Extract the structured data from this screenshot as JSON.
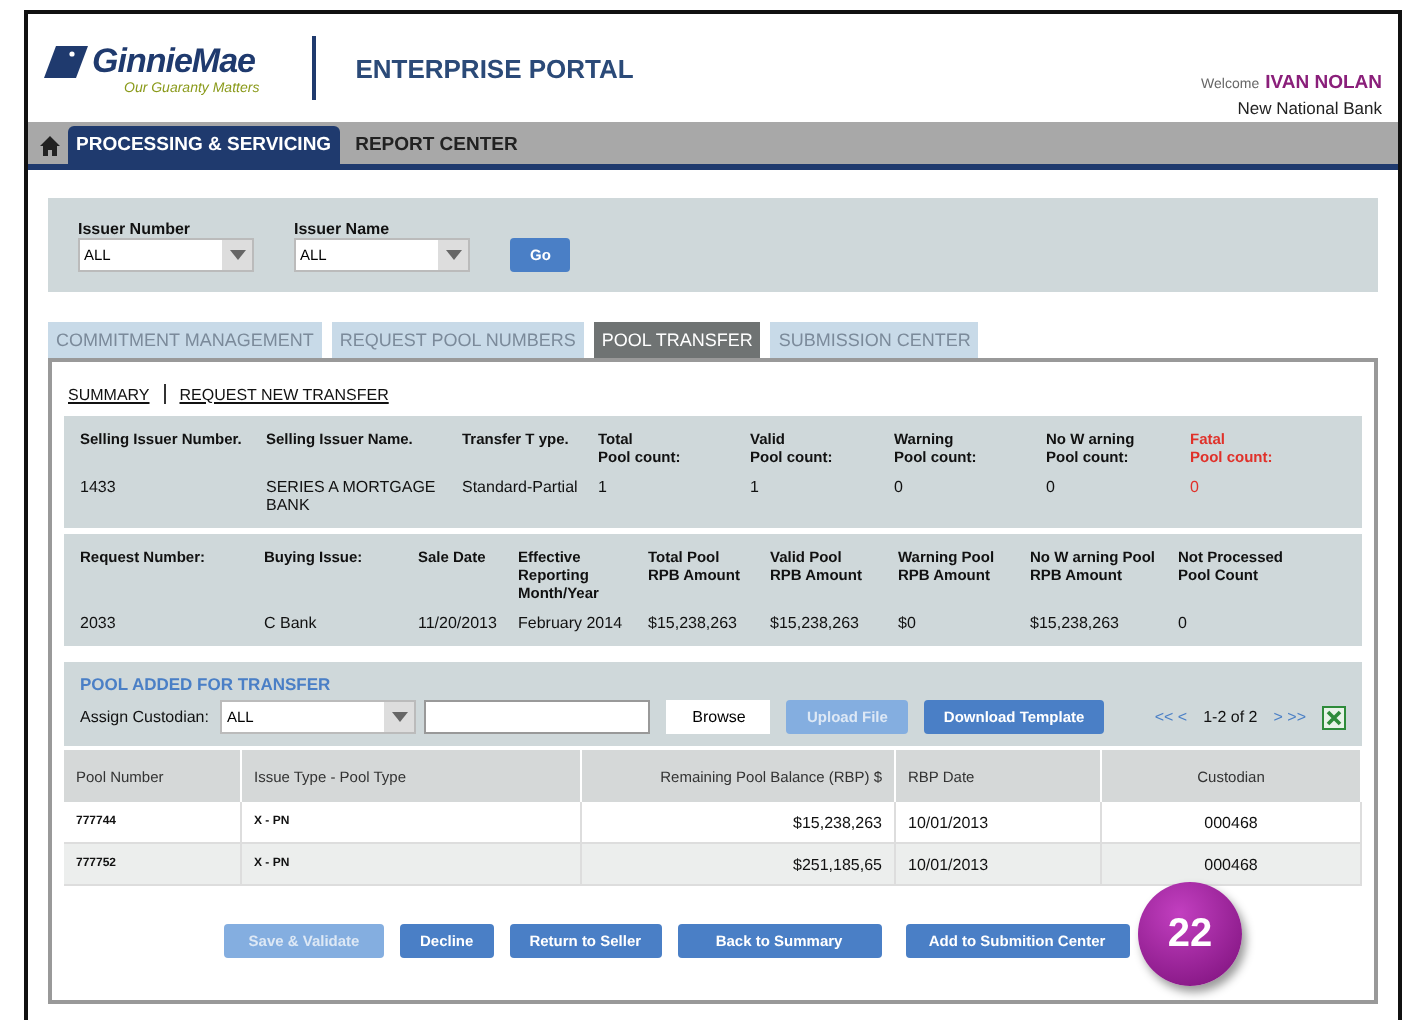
{
  "header": {
    "logo_word_1": "Ginnie",
    "logo_word_2": "Mae",
    "tagline": "Our Guaranty Matters",
    "portal_title": "ENTERPRISE PORTAL",
    "welcome": "Welcome",
    "user_name": "IVAN NOLAN",
    "organization": "New National Bank"
  },
  "nav": [
    {
      "label": "PROCESSING & SERVICING",
      "selected": true
    },
    {
      "label": "REPORT CENTER",
      "selected": false
    }
  ],
  "filters": [
    {
      "label": "Issuer Number",
      "value": "ALL"
    },
    {
      "label": "Issuer Name",
      "value": "ALL"
    }
  ],
  "go_button": "Go",
  "tabs": [
    {
      "label": "COMMITMENT MANAGEMENT",
      "selected": false
    },
    {
      "label": "REQUEST POOL NUMBERS",
      "selected": false
    },
    {
      "label": "POOL TRANSFER",
      "selected": true
    },
    {
      "label": "SUBMISSION CENTER",
      "selected": false
    }
  ],
  "sub_links": [
    "SUMMARY",
    "REQUEST NEW TRANSFER"
  ],
  "transfer_summary": [
    {
      "label_lines": [
        "Selling Issuer Number."
      ],
      "value": "1433",
      "kind": "normal"
    },
    {
      "label_lines": [
        "Selling Issuer Name."
      ],
      "value": "SERIES A MORTGAGE BANK",
      "kind": "normal"
    },
    {
      "label_lines": [
        "Transfer T ype."
      ],
      "value": "Standard-Partial",
      "kind": "normal"
    },
    {
      "label_lines": [
        "Total",
        "Pool count:"
      ],
      "value": "1",
      "kind": "normal"
    },
    {
      "label_lines": [
        "Valid",
        "Pool count:"
      ],
      "value": "1",
      "kind": "normal"
    },
    {
      "label_lines": [
        "Warning",
        "Pool count:"
      ],
      "value": "0",
      "kind": "normal"
    },
    {
      "label_lines": [
        "No W arning",
        "Pool count:"
      ],
      "value": "0",
      "kind": "normal"
    },
    {
      "label_lines": [
        "Fatal",
        "Pool count:"
      ],
      "value": "0",
      "kind": "fatal"
    }
  ],
  "request_details": [
    {
      "label_lines": [
        "Request Number:"
      ],
      "value": "2033"
    },
    {
      "label_lines": [
        "Buying Issue:"
      ],
      "value": "C Bank"
    },
    {
      "label_lines": [
        "Sale Date"
      ],
      "value": "11/20/2013"
    },
    {
      "label_lines": [
        "Effective  Reporting",
        "Month/Year"
      ],
      "value": "February 2014"
    },
    {
      "label_lines": [
        "Total  Pool",
        "RPB Amount"
      ],
      "value": "$15,238,263"
    },
    {
      "label_lines": [
        "Valid Pool",
        "RPB Amount"
      ],
      "value": "$15,238,263"
    },
    {
      "label_lines": [
        "Warning Pool",
        "RPB Amount"
      ],
      "value": "$0"
    },
    {
      "label_lines": [
        "No W arning Pool",
        "RPB Amount"
      ],
      "value": "$15,238,263"
    },
    {
      "label_lines": [
        "Not Processed",
        "Pool Count"
      ],
      "value": "0"
    }
  ],
  "pool_section": {
    "title": "POOL ADDED FOR TRANSFER",
    "custodian_label": "Assign Custodian:",
    "custodian_value": "ALL",
    "browse_button": "Browse",
    "upload_button": {
      "label": "Upload File",
      "disabled": true
    },
    "download_button": "Download Template",
    "first_prev": "<< <",
    "page_info": "1-2 of 2",
    "next_last": "> >>"
  },
  "table": {
    "columns": [
      "Pool Number",
      "Issue Type  - Pool Type",
      "Remaining Pool Balance (RBP) $",
      "RBP Date",
      "Custodian"
    ],
    "rows": [
      [
        "777744",
        "X - PN",
        "$15,238,263",
        "10/01/2013",
        "000468"
      ],
      [
        "777752",
        "X - PN",
        "$251,185,65",
        "10/01/2013",
        "000468"
      ]
    ]
  },
  "buttons": [
    {
      "label": "Save & Validate",
      "disabled": true
    },
    {
      "label": "Decline",
      "disabled": false
    },
    {
      "label": "Return to Seller",
      "disabled": false
    },
    {
      "label": "Back to Summary",
      "disabled": false
    },
    {
      "label": "Add to Submition Center",
      "disabled": false
    }
  ],
  "callout": "22"
}
